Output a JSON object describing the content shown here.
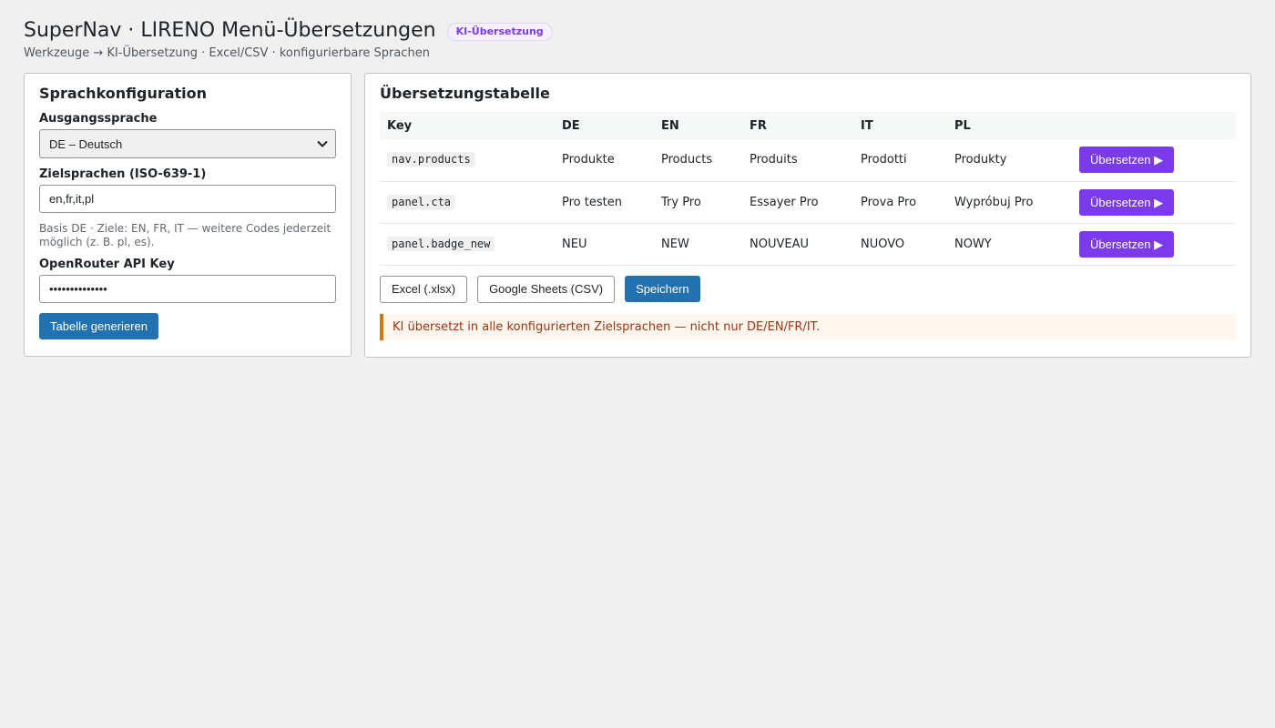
{
  "header": {
    "title": "SuperNav · LIRENO Menü-Übersetzungen",
    "badge": "KI-Übersetzung",
    "breadcrumb": "Werkzeuge → KI-Übersetzung · Excel/CSV · konfigurierbare Sprachen"
  },
  "config": {
    "title": "Sprachkonfiguration",
    "source_label": "Ausgangssprache",
    "source_value": "DE – Deutsch",
    "targets_label": "Zielsprachen (ISO-639-1)",
    "targets_value": "en,fr,it,pl",
    "help_text": "Basis DE · Ziele: EN, FR, IT — weitere Codes jederzeit möglich (z. B. pl, es).",
    "api_label": "OpenRouter API Key",
    "api_value": "••••••••••••••",
    "generate_label": "Tabelle generieren"
  },
  "table": {
    "title": "Übersetzungstabelle",
    "columns": [
      "Key",
      "DE",
      "EN",
      "FR",
      "IT",
      "PL",
      ""
    ],
    "translate_label": "Übersetzen ▶",
    "rows": [
      {
        "key": "nav.products",
        "de": "Produkte",
        "en": "Products",
        "fr": "Produits",
        "it": "Prodotti",
        "pl": "Produkty"
      },
      {
        "key": "panel.cta",
        "de": "Pro testen",
        "en": "Try Pro",
        "fr": "Essayer Pro",
        "it": "Prova Pro",
        "pl": "Wypróbuj Pro"
      },
      {
        "key": "panel.badge_new",
        "de": "NEU",
        "en": "NEW",
        "fr": "NOUVEAU",
        "it": "NUOVO",
        "pl": "NOWY"
      }
    ]
  },
  "actions": {
    "excel_label": "Excel (.xlsx)",
    "sheets_label": "Google Sheets (CSV)",
    "save_label": "Speichern"
  },
  "notice": "KI übersetzt in alle konfigurierten Zielsprachen — nicht nur DE/EN/FR/IT.",
  "colors": {
    "accent": "#2271b1",
    "purple": "#7c3aed",
    "warning": "#d97706"
  }
}
